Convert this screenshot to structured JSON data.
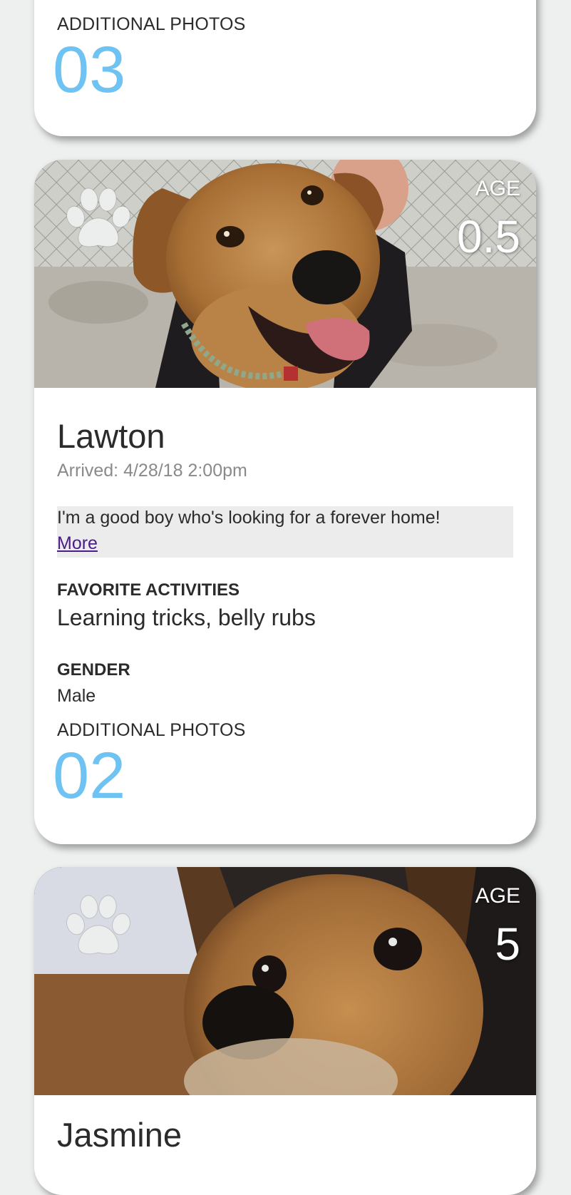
{
  "cards": [
    {
      "additional_photos_label": "ADDITIONAL PHOTOS",
      "additional_photos_count": "03"
    },
    {
      "paw_icon": "paw-icon",
      "age_label": "AGE",
      "age_value": "0.5",
      "name": "Lawton",
      "arrived": "Arrived: 4/28/18 2:00pm",
      "description": "I'm a good boy who's looking for a forever home!",
      "more_link": "More",
      "favorite_activities_label": "FAVORITE ACTIVITIES",
      "favorite_activities": "Learning tricks, belly rubs",
      "gender_label": "GENDER",
      "gender": "Male",
      "additional_photos_label": "ADDITIONAL PHOTOS",
      "additional_photos_count": "02"
    },
    {
      "paw_icon": "paw-icon",
      "age_label": "AGE",
      "age_value": "5",
      "name": "Jasmine"
    }
  ],
  "colors": {
    "background": "#eef0ef",
    "card": "#ffffff",
    "photo_count": "#6fc3f2",
    "link": "#4b1c8a",
    "description_bg": "#ececec"
  }
}
